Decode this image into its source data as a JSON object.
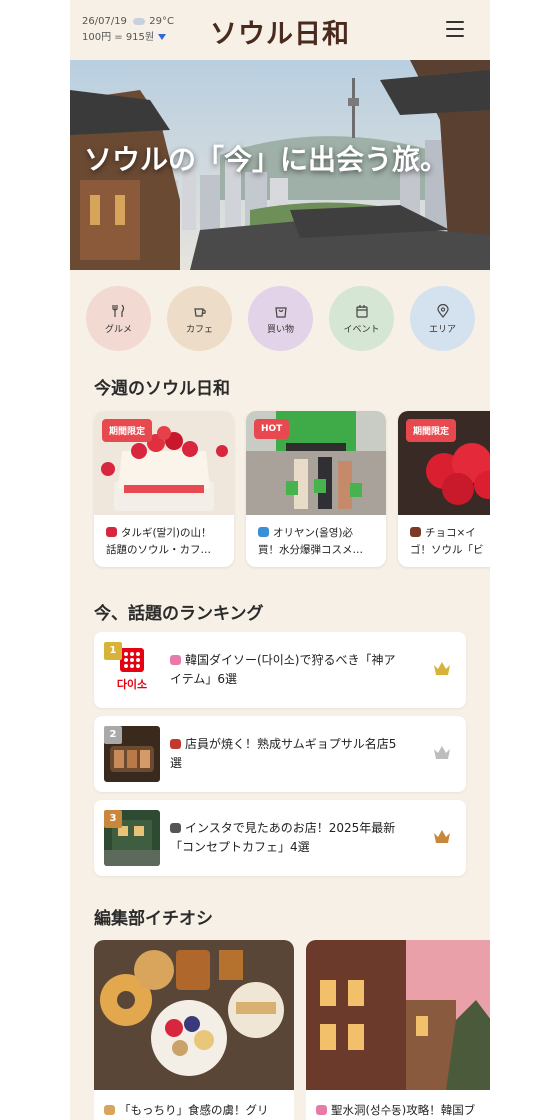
{
  "header": {
    "date_weather": "26/07/19",
    "weather_icon": "cloud-icon",
    "temperature": "29°C",
    "exchange_rate": "100円 = 915원",
    "logo": "ソウル日和"
  },
  "hero": {
    "title": "ソウルの「今」に出会う旅。"
  },
  "categories": [
    {
      "label": "グルメ",
      "icon": "utensils-icon",
      "color": "#f2d9d2"
    },
    {
      "label": "カフェ",
      "icon": "coffee-icon",
      "color": "#ecdcc8"
    },
    {
      "label": "買い物",
      "icon": "shopping-bag-icon",
      "color": "#e3d3e8"
    },
    {
      "label": "イベント",
      "icon": "calendar-icon",
      "color": "#d6e6d4"
    },
    {
      "label": "エリア",
      "icon": "map-pin-icon",
      "color": "#d4e2f0"
    }
  ],
  "weekly": {
    "title": "今週のソウル日和",
    "cards": [
      {
        "badge": "期間限定",
        "line1": "タルギ(딸기)の山！",
        "line2": "話題のソウル・カフ…"
      },
      {
        "badge": "HOT",
        "line1": "オリヤン(올영)必",
        "line2": "買！水分爆弾コスメ…"
      },
      {
        "badge": "期間限定",
        "line1": "チョコ×イ",
        "line2": "ゴ！ソウル「ビ"
      }
    ]
  },
  "ranking": {
    "title": "今、話題のランキング",
    "items": [
      {
        "rank": "1",
        "line1": "韓国ダイソー(다이소)で狩るべき「神ア",
        "line2": "イテム」6選",
        "thumb_text": "다이소",
        "medal_color": "#d8b33a"
      },
      {
        "rank": "2",
        "line1": "店員が焼く！熟成サムギョプサル名店5",
        "line2": "選",
        "medal_color": "#bdbdbd"
      },
      {
        "rank": "3",
        "line1": "インスタで見たあのお店！2025年最新",
        "line2": "「コンセプトカフェ」4選",
        "medal_color": "#c8873a"
      }
    ]
  },
  "editors": {
    "title": "編集部イチオシ",
    "cards": [
      {
        "text": "「もっちり」食感の虜！グリ"
      },
      {
        "text": "聖水洞(성수동)攻略！韓国ブ"
      }
    ]
  }
}
